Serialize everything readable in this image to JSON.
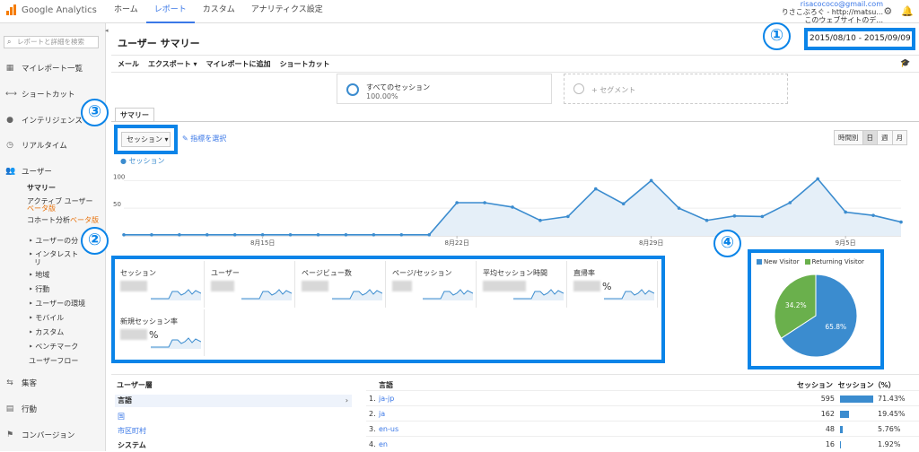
{
  "header": {
    "logo_text": "Google Analytics",
    "nav": [
      "ホーム",
      "レポート",
      "カスタム",
      "アナリティクス設定"
    ],
    "account_email": "risacococo@gmail.com",
    "account_name": "りさこぶろぐ - http://matsu...",
    "account_view": "このウェブサイトのデ..."
  },
  "sidebar": {
    "search_placeholder": "レポートと詳細を検索",
    "items": {
      "my_reports": "マイレポート一覧",
      "shortcuts": "ショートカット",
      "intelligence": "インテリジェンス",
      "realtime": "リアルタイム",
      "users": "ユーザー",
      "acquisition": "集客",
      "behavior": "行動",
      "conversion": "コンバージョン"
    },
    "sub": {
      "summary": "サマリー",
      "active_users": "アクティブ ユーザー",
      "beta1": "ベータ版",
      "cohort": "コホート分析",
      "beta2": "ベータ版",
      "user_interest": "‣ ユーザーの分",
      "interest": "‣ インタレスト",
      "interest2": "リ",
      "region": "‣ 地域",
      "behavior": "‣ 行動",
      "environment": "‣ ユーザーの環境",
      "mobile": "‣ モバイル",
      "custom": "‣ カスタム",
      "benchmark": "‣ ベンチマーク",
      "user_flow": "ユーザーフロー"
    }
  },
  "page": {
    "title": "ユーザー サマリー",
    "date_range": "2015/08/10 - 2015/09/09",
    "toolbar": [
      "メール",
      "エクスポート ▾",
      "マイレポートに追加",
      "ショートカット"
    ],
    "segment1_label": "すべてのセッション",
    "segment1_pct": "100.00%",
    "segment2_label": "+ セグメント",
    "tab": "サマリー",
    "metric_select": "セッション",
    "choose_metric": "指標を選択",
    "periods": [
      "時間別",
      "日",
      "週",
      "月"
    ],
    "legend": "セッション"
  },
  "callouts": [
    "①",
    "②",
    "③",
    "④"
  ],
  "chart_data": {
    "type": "area",
    "series": [
      {
        "name": "セッション",
        "values": [
          2,
          2,
          2,
          2,
          2,
          2,
          2,
          2,
          2,
          2,
          2,
          2,
          2,
          2,
          2,
          2,
          2,
          2,
          2,
          2,
          2,
          2,
          2,
          2,
          2,
          2,
          2,
          2,
          2,
          2,
          2,
          2,
          2,
          2,
          2,
          2,
          2,
          2,
          2,
          2,
          2,
          2,
          2,
          2,
          2,
          2,
          2,
          2,
          2,
          2,
          2,
          2,
          2,
          2,
          2,
          2,
          2,
          2,
          2,
          2,
          2
        ]
      }
    ],
    "values": [
      2,
      2,
      2,
      2,
      2,
      2,
      2,
      2,
      2,
      2,
      2,
      2,
      2,
      2,
      2,
      2,
      2,
      2,
      2,
      2,
      2,
      2,
      2,
      2,
      2,
      2,
      2,
      2,
      2,
      2,
      2,
      2,
      2,
      2,
      2,
      2,
      2,
      2,
      2,
      2,
      2,
      2,
      2,
      2,
      2,
      2,
      2,
      2,
      2,
      2,
      2,
      2,
      2,
      2,
      2,
      2,
      2,
      2,
      2,
      2,
      2
    ],
    "points": [
      2,
      2,
      2,
      2,
      2,
      2,
      2,
      2,
      2,
      2,
      2,
      2,
      2,
      2,
      2,
      2,
      2,
      2,
      2,
      2,
      2,
      2,
      2,
      2,
      2,
      2,
      2,
      2,
      2,
      2,
      2,
      2,
      2,
      2,
      2,
      2,
      2,
      2,
      2,
      2,
      2,
      2,
      2,
      2,
      2,
      2,
      2,
      2,
      2,
      2,
      2,
      2,
      2,
      2,
      2,
      2,
      2,
      2,
      2,
      2,
      2
    ],
    "daily": [
      2,
      2,
      2,
      2,
      2,
      2,
      2,
      2,
      2,
      2,
      2,
      2,
      2,
      2,
      2,
      2,
      2,
      2,
      2,
      2,
      2,
      2,
      2,
      2,
      2,
      2,
      2,
      2,
      2,
      2,
      2,
      2,
      2,
      2,
      2,
      2,
      2,
      2,
      2,
      2,
      2,
      2,
      2,
      2,
      2,
      2,
      2,
      2,
      2,
      2,
      2,
      2,
      2,
      2,
      2,
      2,
      2,
      2,
      2,
      2,
      2
    ],
    "y_ticks": [
      "100",
      "50"
    ],
    "x_ticks": [
      "8月15日",
      "8月22日",
      "8月29日",
      "9月5日"
    ],
    "ylim": [
      0,
      120
    ],
    "data": [
      2,
      2,
      2,
      2,
      2,
      2,
      2,
      2,
      2,
      2,
      2,
      2,
      2,
      2,
      2,
      2,
      2,
      2,
      2,
      2,
      2,
      2,
      2,
      2,
      2,
      2,
      2,
      2,
      2,
      2,
      2,
      2,
      2,
      2,
      2,
      2,
      2,
      2,
      2,
      2,
      2,
      2,
      2,
      2,
      2,
      2,
      2,
      2,
      2,
      2,
      2,
      2,
      2,
      2,
      2,
      2,
      2,
      2,
      2,
      2,
      2
    ],
    "raw": [
      2,
      2,
      2,
      2,
      2,
      2,
      2,
      2,
      2,
      2,
      2,
      2,
      60,
      60,
      52,
      28,
      35,
      85,
      58,
      100,
      50,
      28,
      36,
      35,
      60,
      103,
      43,
      37,
      25
    ],
    "days": 31
  },
  "pie_data": {
    "type": "pie",
    "legend": [
      "New Visitor",
      "Returning Visitor"
    ],
    "values": [
      65.8,
      34.2
    ],
    "labels": [
      "65.8%",
      "34.2%"
    ],
    "colors": [
      "#3b8ccf",
      "#6ab04c"
    ]
  },
  "metrics": [
    {
      "name": "セッション"
    },
    {
      "name": "ユーザー"
    },
    {
      "name": "ページビュー数"
    },
    {
      "name": "ページ/セッション"
    },
    {
      "name": "平均セッション時間"
    },
    {
      "name": "直帰率",
      "unit": "%"
    },
    {
      "name": "新規セッション率",
      "unit": "%"
    }
  ],
  "user_layer": {
    "heading": "ユーザー層",
    "items": [
      "言語",
      "国",
      "市区町村",
      "システム"
    ]
  },
  "language_table": {
    "col_lang": "言語",
    "col_sessions": "セッション",
    "col_pct": "セッション（%）",
    "rows": [
      {
        "rank": "1.",
        "lang": "ja-jp",
        "sessions": "595",
        "pct": "71.43%",
        "share": 71.43
      },
      {
        "rank": "2.",
        "lang": "ja",
        "sessions": "162",
        "pct": "19.45%",
        "share": 19.45
      },
      {
        "rank": "3.",
        "lang": "en-us",
        "sessions": "48",
        "pct": "5.76%",
        "share": 5.76
      },
      {
        "rank": "4.",
        "lang": "en",
        "sessions": "16",
        "pct": "1.92%",
        "share": 1.92
      }
    ]
  }
}
